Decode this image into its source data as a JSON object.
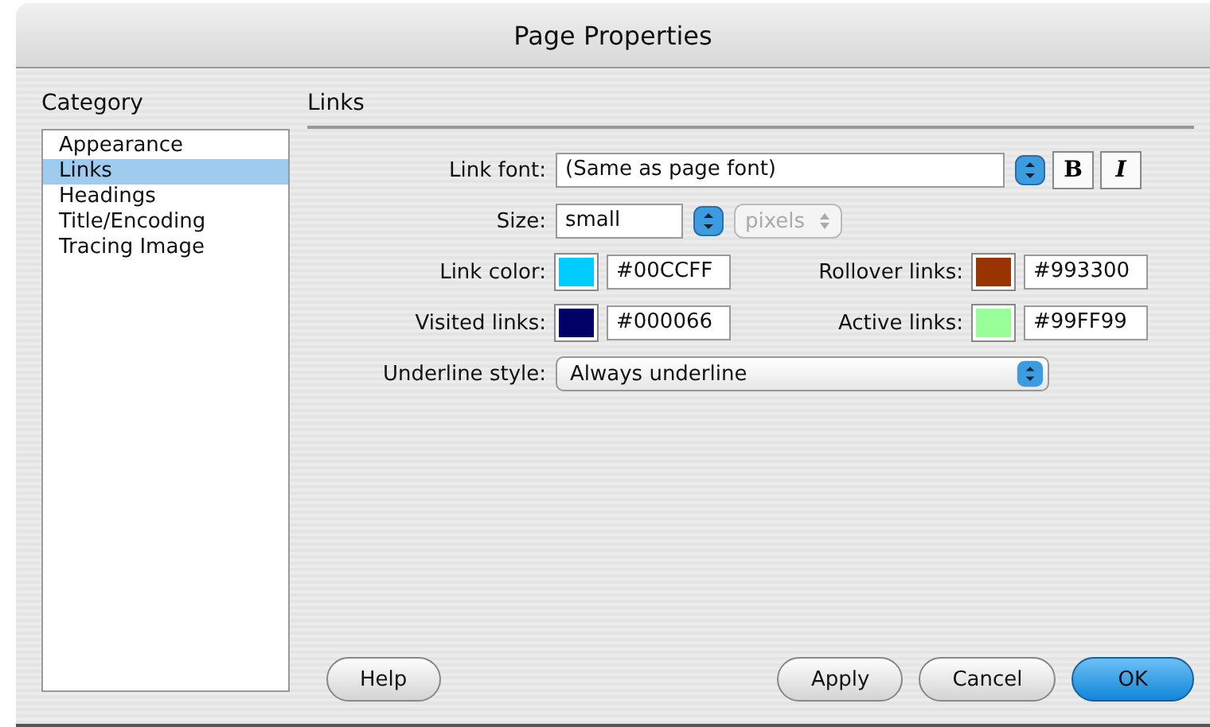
{
  "window": {
    "title": "Page Properties"
  },
  "category": {
    "label": "Category",
    "items": [
      {
        "label": "Appearance",
        "selected": false
      },
      {
        "label": "Links",
        "selected": true
      },
      {
        "label": "Headings",
        "selected": false
      },
      {
        "label": "Title/Encoding",
        "selected": false
      },
      {
        "label": "Tracing Image",
        "selected": false
      }
    ]
  },
  "section": {
    "title": "Links"
  },
  "link_font": {
    "label": "Link font:",
    "value": "(Same as page font)",
    "bold_label": "B",
    "italic_label": "I"
  },
  "size": {
    "label": "Size:",
    "value": "small",
    "unit": "pixels",
    "unit_disabled": true
  },
  "colors": [
    [
      {
        "label": "Link color:",
        "color": "#00ccff",
        "value": "#00CCFF"
      },
      {
        "label": "Rollover links:",
        "color": "#993300",
        "value": "#993300"
      }
    ],
    [
      {
        "label": "Visited links:",
        "color": "#000066",
        "value": "#000066"
      },
      {
        "label": "Active links:",
        "color": "#99ff99",
        "value": "#99FF99"
      }
    ]
  ],
  "underline": {
    "label": "Underline style:",
    "value": "Always underline"
  },
  "buttons": [
    {
      "label": "Help",
      "kind": "help"
    },
    {
      "label": "Apply",
      "kind": "normal"
    },
    {
      "label": "Cancel",
      "kind": "normal"
    },
    {
      "label": "OK",
      "kind": "default"
    }
  ]
}
